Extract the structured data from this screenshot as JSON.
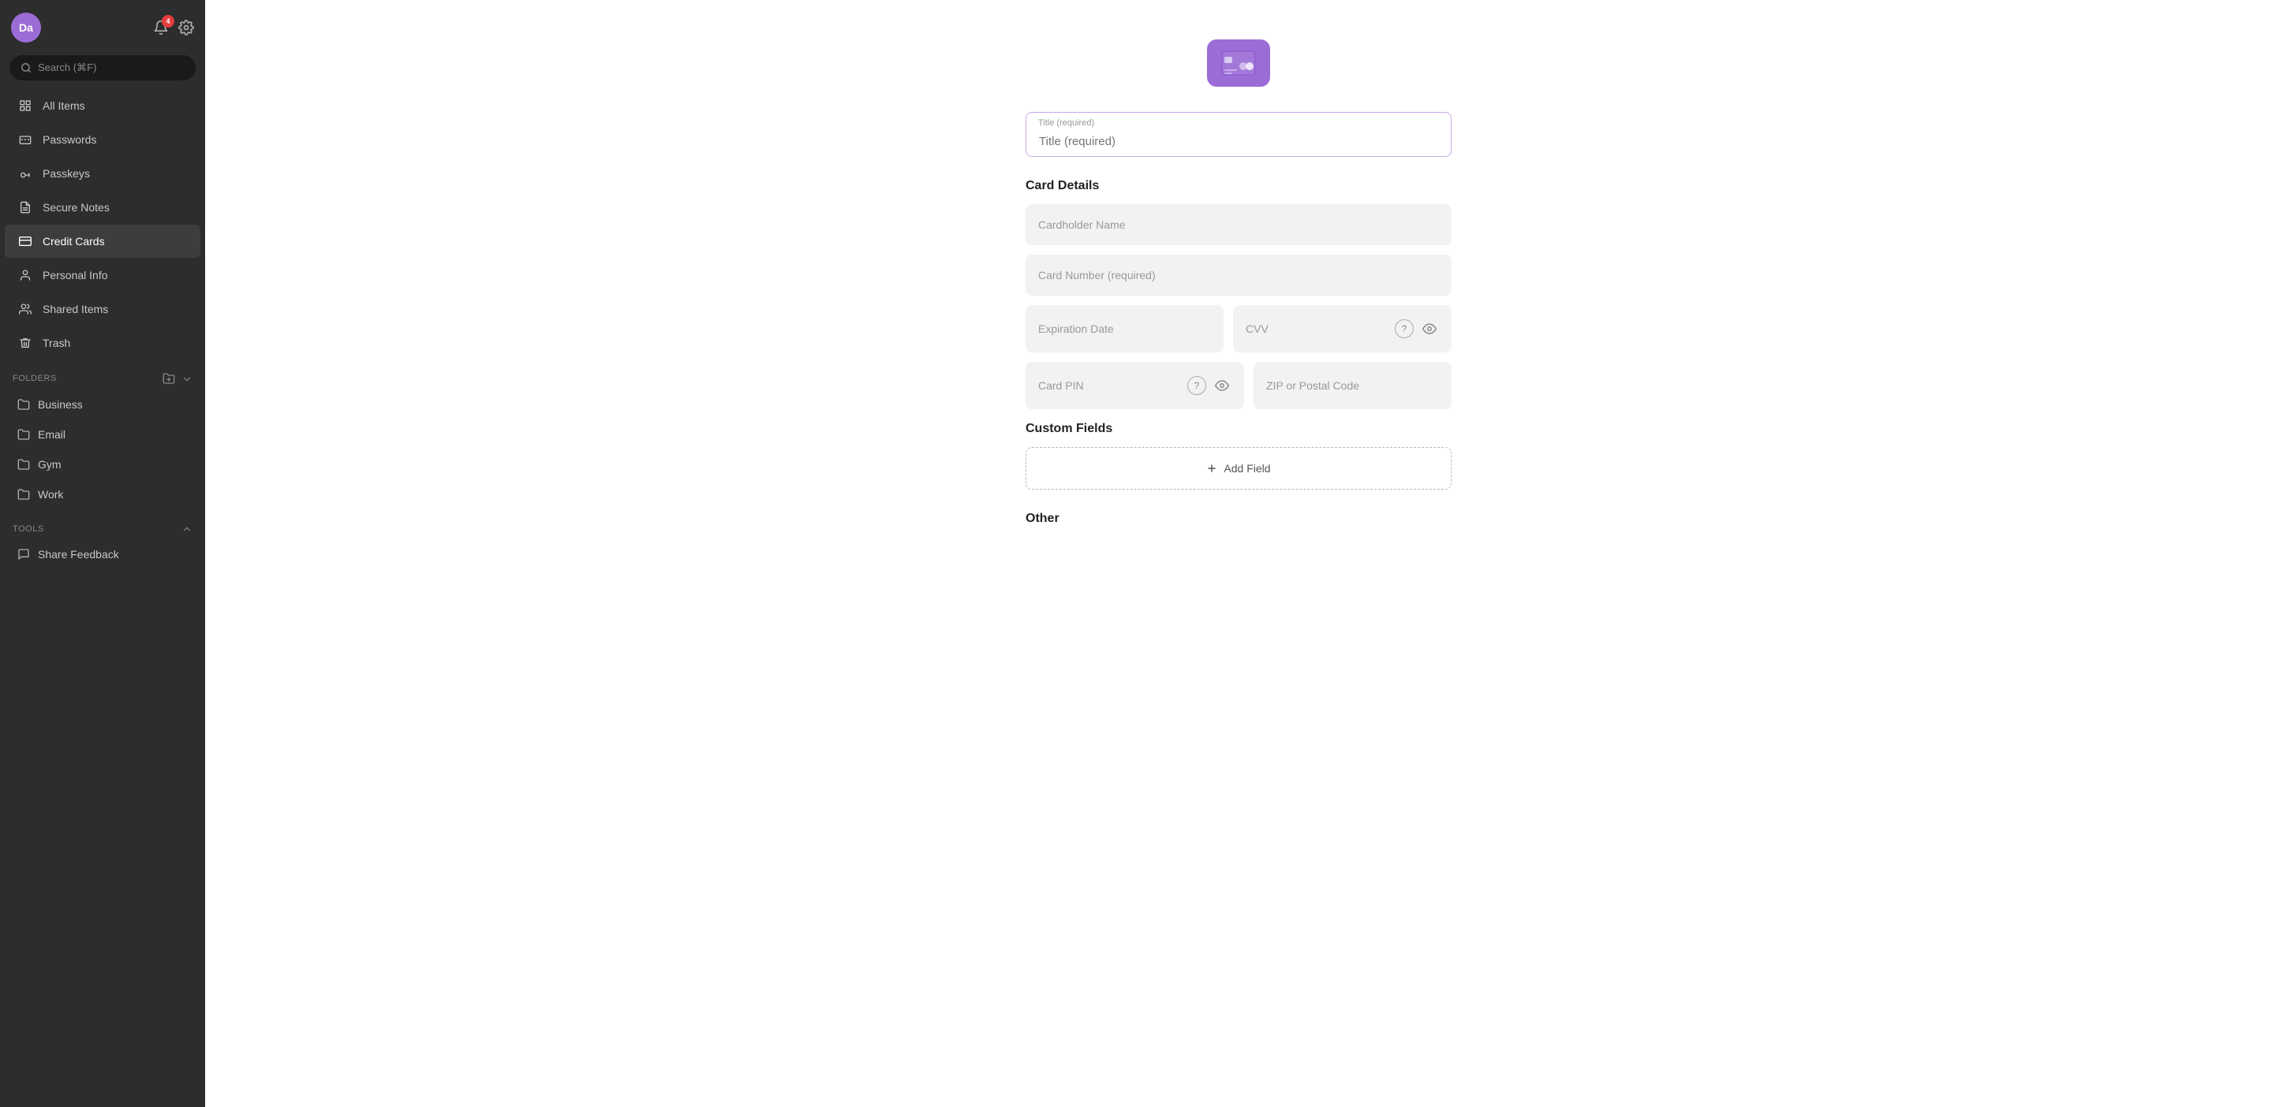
{
  "sidebar": {
    "avatar_initials": "Da",
    "notification_count": "4",
    "search_placeholder": "Search (⌘F)",
    "nav_items": [
      {
        "id": "all-items",
        "label": "All Items",
        "icon": "grid"
      },
      {
        "id": "passwords",
        "label": "Passwords",
        "icon": "card"
      },
      {
        "id": "passkeys",
        "label": "Passkeys",
        "icon": "key"
      },
      {
        "id": "secure-notes",
        "label": "Secure Notes",
        "icon": "note"
      },
      {
        "id": "credit-cards",
        "label": "Credit Cards",
        "icon": "creditcard",
        "active": true
      },
      {
        "id": "personal-info",
        "label": "Personal Info",
        "icon": "person"
      },
      {
        "id": "shared-items",
        "label": "Shared Items",
        "icon": "shared"
      },
      {
        "id": "trash",
        "label": "Trash",
        "icon": "trash"
      }
    ],
    "folders_label": "Folders",
    "folders": [
      {
        "id": "business",
        "label": "Business"
      },
      {
        "id": "email",
        "label": "Email"
      },
      {
        "id": "gym",
        "label": "Gym"
      },
      {
        "id": "work",
        "label": "Work"
      }
    ],
    "tools_label": "Tools",
    "feedback_label": "Share Feedback"
  },
  "main": {
    "title_placeholder": "Title (required)",
    "card_details_label": "Card Details",
    "cardholder_name_placeholder": "Cardholder Name",
    "card_number_placeholder": "Card Number (required)",
    "expiration_date_placeholder": "Expiration Date",
    "cvv_placeholder": "CVV",
    "card_pin_placeholder": "Card PIN",
    "zip_placeholder": "ZIP or Postal Code",
    "custom_fields_label": "Custom Fields",
    "add_field_label": "+ Add Field",
    "other_label": "Other"
  }
}
